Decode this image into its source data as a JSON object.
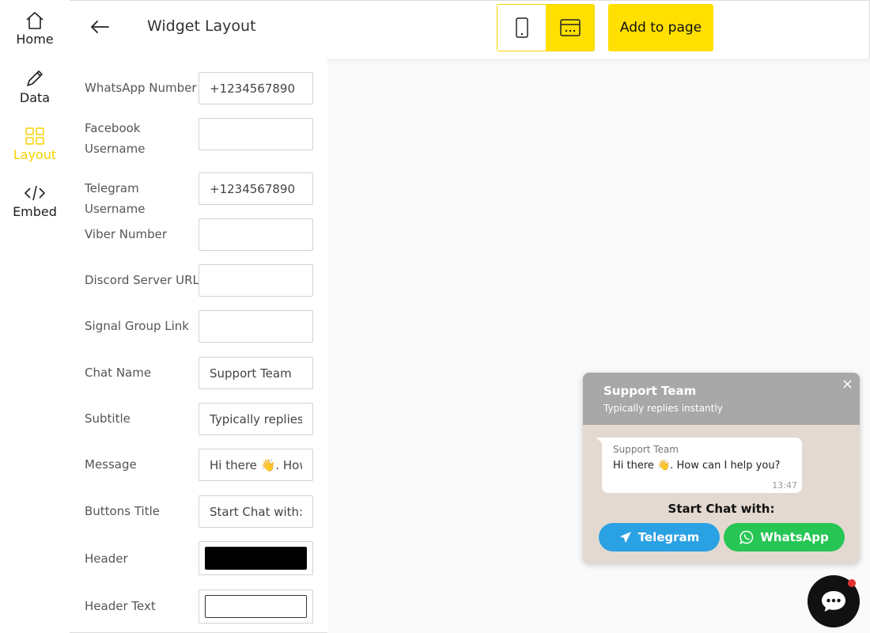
{
  "nav": {
    "items": [
      {
        "label": "Home",
        "icon": "home-icon"
      },
      {
        "label": "Data",
        "icon": "pencil-icon"
      },
      {
        "label": "Layout",
        "icon": "grid-icon",
        "active": true
      },
      {
        "label": "Embed",
        "icon": "code-icon"
      }
    ]
  },
  "header": {
    "title": "Widget Layout",
    "add_button": "Add to page",
    "view_modes": [
      "mobile",
      "desktop"
    ],
    "active_view": "desktop"
  },
  "form": {
    "fields": [
      {
        "label": "WhatsApp Number",
        "value": "+1234567890"
      },
      {
        "label": "Facebook Username",
        "value": ""
      },
      {
        "label": "Telegram Username",
        "value": "+1234567890"
      },
      {
        "label": "Viber Number",
        "value": ""
      },
      {
        "label": "Discord Server URL",
        "value": ""
      },
      {
        "label": "Signal Group Link",
        "value": ""
      },
      {
        "label": "Chat Name",
        "value": "Support Team"
      },
      {
        "label": "Subtitle",
        "value": "Typically replies instantly"
      },
      {
        "label": "Message",
        "value": "Hi there 👋. How can I help you?"
      },
      {
        "label": "Buttons Title",
        "value": "Start Chat with:"
      }
    ],
    "colors": [
      {
        "label": "Header",
        "value": "#000000"
      },
      {
        "label": "Header Text",
        "value": "#ffffff"
      }
    ]
  },
  "widget": {
    "name": "Support Team",
    "subtitle": "Typically replies instantly",
    "close": "×",
    "bubble_name": "Support Team",
    "message": "Hi there 👋. How can I help you?",
    "time": "13:47",
    "buttons_title": "Start Chat with:",
    "buttons": [
      {
        "label": "Telegram",
        "color": "#2aa1e3"
      },
      {
        "label": "WhatsApp",
        "color": "#27c654"
      }
    ]
  },
  "colors": {
    "accent": "#ffe000",
    "header_bg": "#a8a8a8",
    "chat_bg": "#e3d9d0",
    "notification": "#e53030"
  }
}
